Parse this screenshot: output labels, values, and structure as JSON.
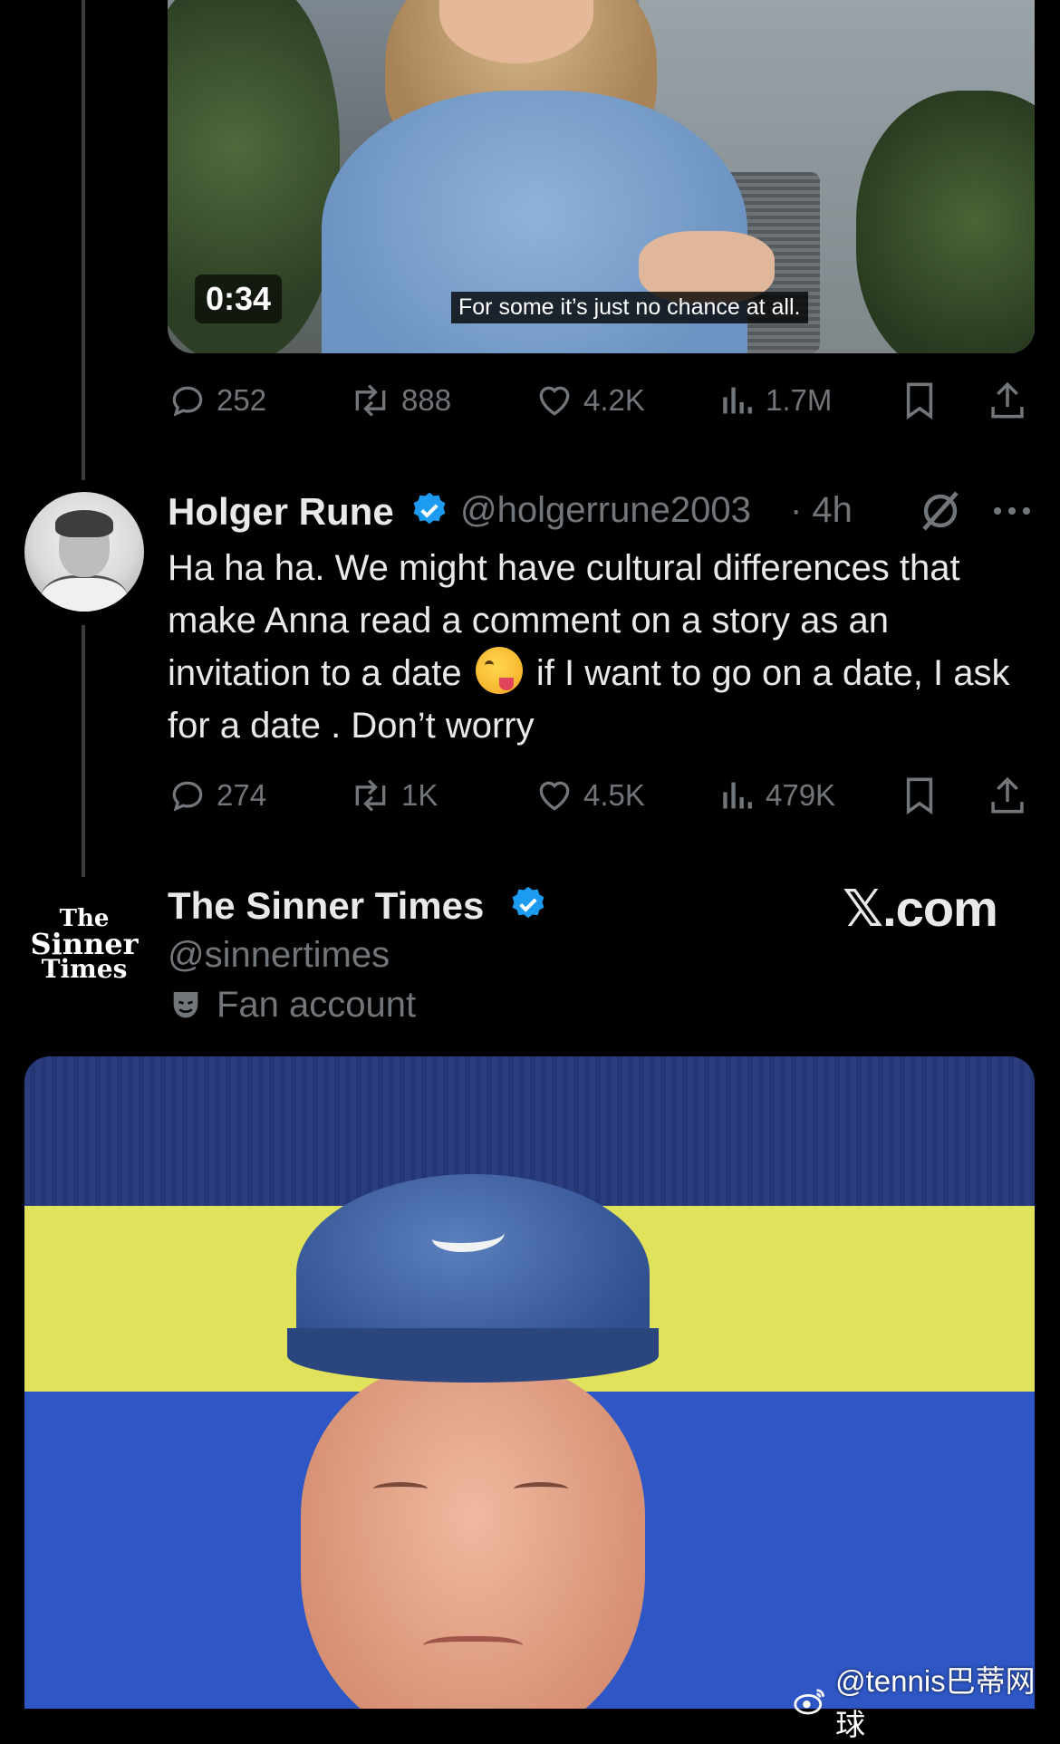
{
  "video": {
    "timestamp": "0:34",
    "caption": "For some it’s just no chance at all."
  },
  "tweet1_actions": {
    "replies": "252",
    "reposts": "888",
    "likes": "4.2K",
    "views": "1.7M"
  },
  "tweet2": {
    "name": "Holger Rune",
    "handle": "@holgerrune2003",
    "time": "· 4h",
    "text_before_emoji": "Ha ha ha. We might have cultural differences that make Anna read a comment on a story as an invitation to a date",
    "text_after_emoji": "if I want to go on a date, I ask for a date . Don’t worry",
    "emoji": "😜",
    "actions": {
      "replies": "274",
      "reposts": "1K",
      "likes": "4.5K",
      "views": "479K"
    }
  },
  "tweet3": {
    "name": "The Sinner Times",
    "handle": "@sinnertimes",
    "label": "Fan account",
    "logo_lines": [
      "The",
      "Sinner",
      "Times"
    ]
  },
  "xcom": "𝕏.com",
  "watermark": "@tennis巴蒂网球",
  "colors": {
    "background": "#000000",
    "text": "#e7e9ea",
    "muted": "#71767b",
    "verified": "#1d9bf0"
  }
}
